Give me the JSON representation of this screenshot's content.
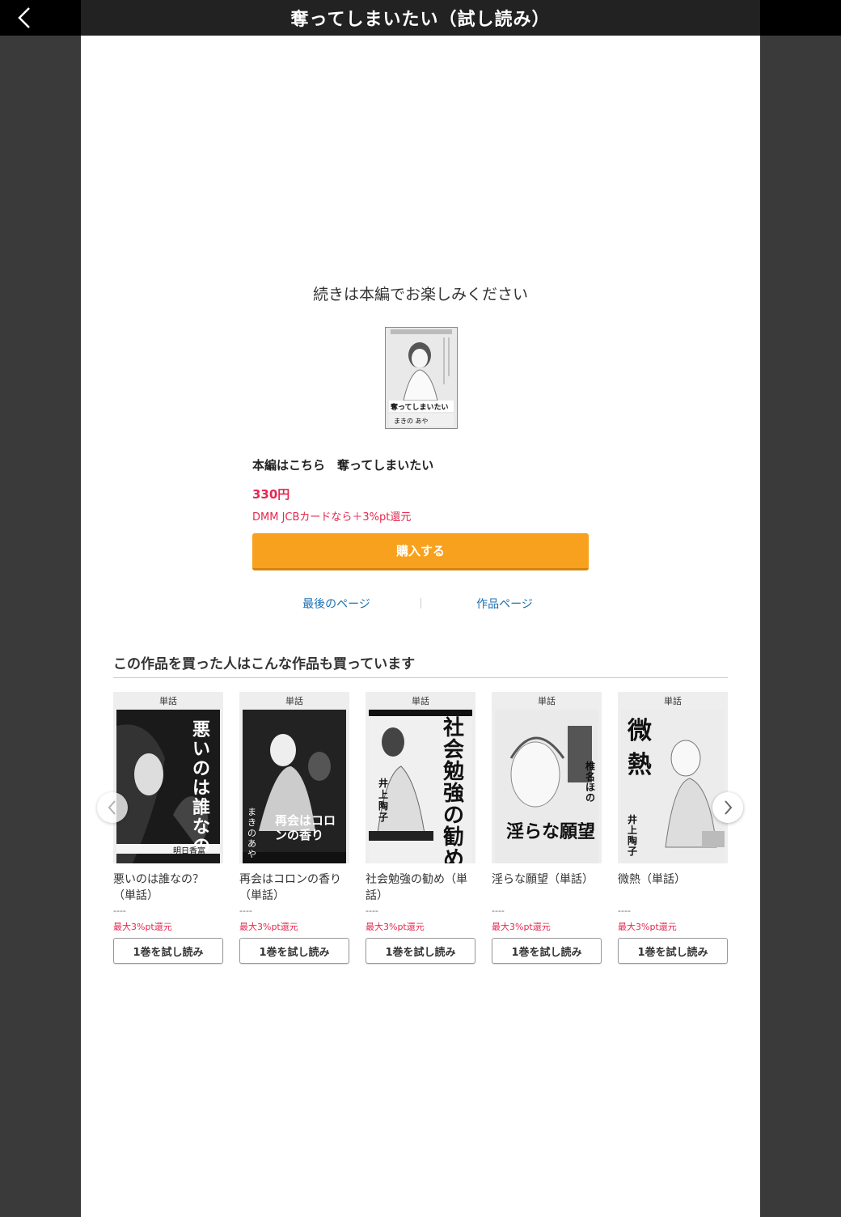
{
  "header": {
    "title": "奪ってしまいたい（試し読み）"
  },
  "main": {
    "continue_message": "続きは本編でお楽しみください",
    "product_title": "本編はこちら　奪ってしまいたい",
    "price": "330円",
    "cashback": "DMM JCBカードなら＋3%pt還元",
    "buy_label": "購入する",
    "links": {
      "last_page": "最後のページ",
      "work_page": "作品ページ"
    },
    "cover_text": {
      "title": "奪ってしまいたい",
      "author": "まきの あや"
    }
  },
  "recommendations": {
    "heading": "この作品を買った人はこんな作品も買っています",
    "items": [
      {
        "badge": "単話",
        "title": "悪いのは誰なの？（単話）",
        "price": "----",
        "cashback": "最大3%pt還元",
        "trial_label": "1巻を試し読み",
        "cover_text": "悪いのは誰なの",
        "cover_author": "明日香富"
      },
      {
        "badge": "単話",
        "title": "再会はコロンの香り（単話）",
        "price": "----",
        "cashback": "最大3%pt還元",
        "trial_label": "1巻を試し読み",
        "cover_text": "再会はコロンの香り",
        "cover_author": "まきの あや"
      },
      {
        "badge": "単話",
        "title": "社会勉強の勧め（単話）",
        "price": "----",
        "cashback": "最大3%pt還元",
        "trial_label": "1巻を試し読み",
        "cover_text": "社会勉強の勧め",
        "cover_author": "井上陶子"
      },
      {
        "badge": "単話",
        "title": "淫らな願望（単話）",
        "price": "----",
        "cashback": "最大3%pt還元",
        "trial_label": "1巻を試し読み",
        "cover_text": "淫らな願望",
        "cover_author": "椎名ほの"
      },
      {
        "badge": "単話",
        "title": "微熱（単話）",
        "price": "----",
        "cashback": "最大3%pt還元",
        "trial_label": "1巻を試し読み",
        "cover_text": "微熱",
        "cover_author": "井上陶子"
      }
    ]
  },
  "icons": {
    "back": "chevron-left-icon",
    "prev": "chevron-left-icon",
    "next": "chevron-right-icon"
  },
  "colors": {
    "accent": "#f7a11e",
    "price": "#e5284f",
    "link": "#1a6fb0"
  }
}
